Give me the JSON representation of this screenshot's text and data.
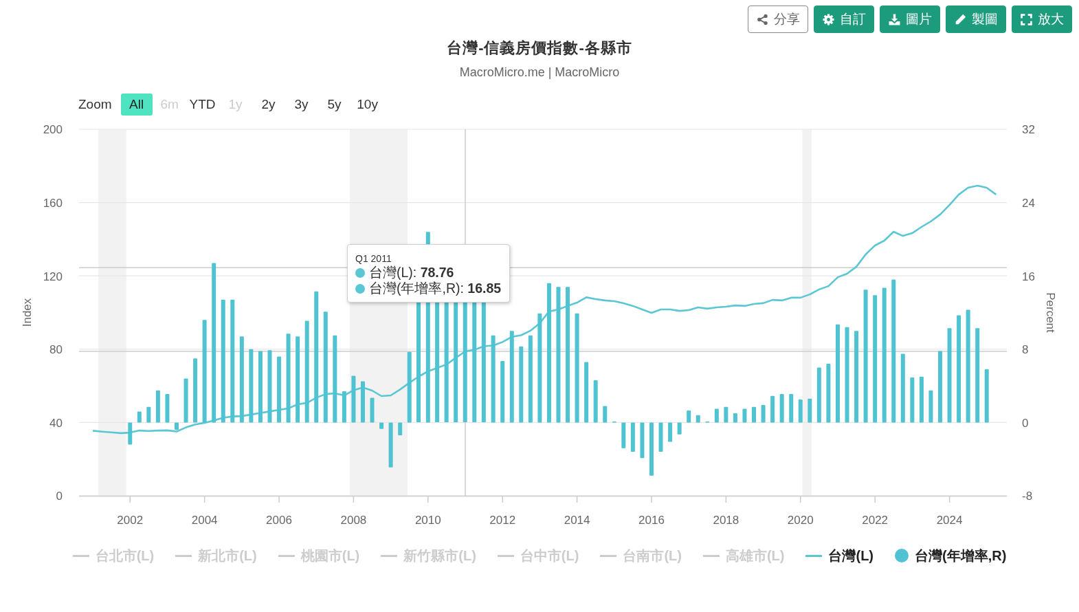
{
  "toolbar": [
    {
      "label": "分享",
      "kind": "outline"
    },
    {
      "label": "自訂",
      "kind": "filled"
    },
    {
      "label": "圖片",
      "kind": "filled"
    },
    {
      "label": "製圖",
      "kind": "filled"
    },
    {
      "label": "放大",
      "kind": "filled"
    }
  ],
  "title": "台灣-信義房價指數-各縣市",
  "subtitle": "MacroMicro.me | MacroMicro",
  "range_selector": {
    "label": "Zoom",
    "buttons": [
      {
        "label": "All",
        "selected": true,
        "disabled": false
      },
      {
        "label": "6m",
        "selected": false,
        "disabled": true
      },
      {
        "label": "YTD",
        "selected": false,
        "disabled": false
      },
      {
        "label": "1y",
        "selected": false,
        "disabled": true
      },
      {
        "label": "2y",
        "selected": false,
        "disabled": false
      },
      {
        "label": "3y",
        "selected": false,
        "disabled": false
      },
      {
        "label": "5y",
        "selected": false,
        "disabled": false
      },
      {
        "label": "10y",
        "selected": false,
        "disabled": false
      }
    ]
  },
  "chart": {
    "chart_data": {
      "type": "bar",
      "ylabel": "Index",
      "y2label": "Percent",
      "xlim": [
        2000.63,
        2025.54
      ],
      "ylim": [
        0,
        200
      ],
      "y2lim": [
        -8,
        32
      ],
      "xticks": [
        2002,
        2004,
        2006,
        2008,
        2010,
        2012,
        2014,
        2016,
        2018,
        2020,
        2022,
        2024
      ],
      "yticks": [
        0,
        40,
        80,
        120,
        160,
        200
      ],
      "y2ticks": [
        -8,
        0,
        8,
        16,
        24,
        32
      ],
      "grid": true,
      "x": [
        2001,
        2001.25,
        2001.5,
        2001.75,
        2002,
        2002.25,
        2002.5,
        2002.75,
        2003,
        2003.25,
        2003.5,
        2003.75,
        2004,
        2004.25,
        2004.5,
        2004.75,
        2005,
        2005.25,
        2005.5,
        2005.75,
        2006,
        2006.25,
        2006.5,
        2006.75,
        2007,
        2007.25,
        2007.5,
        2007.75,
        2008,
        2008.25,
        2008.5,
        2008.75,
        2009,
        2009.25,
        2009.5,
        2009.75,
        2010,
        2010.25,
        2010.5,
        2010.75,
        2011,
        2011.25,
        2011.5,
        2011.75,
        2012,
        2012.25,
        2012.5,
        2012.75,
        2013,
        2013.25,
        2013.5,
        2013.75,
        2014,
        2014.25,
        2014.5,
        2014.75,
        2015,
        2015.25,
        2015.5,
        2015.75,
        2016,
        2016.25,
        2016.5,
        2016.75,
        2017,
        2017.25,
        2017.5,
        2017.75,
        2018,
        2018.25,
        2018.5,
        2018.75,
        2019,
        2019.25,
        2019.5,
        2019.75,
        2020,
        2020.25,
        2020.5,
        2020.75,
        2021,
        2021.25,
        2021.5,
        2021.75,
        2022,
        2022.25,
        2022.5,
        2022.75,
        2023,
        2023.25,
        2023.5,
        2023.75,
        2024,
        2024.25,
        2024.5,
        2024.75,
        2025,
        2025.25
      ],
      "series": [
        {
          "name": "台灣(L)",
          "type": "line",
          "color": "#5bc6d4",
          "values": [
            35.5,
            35.0,
            34.6,
            34.2,
            34.5,
            35.6,
            35.4,
            35.6,
            35.7,
            35.1,
            37.3,
            38.9,
            39.8,
            41.1,
            42.6,
            43.3,
            43.5,
            44.3,
            45.2,
            46.0,
            46.9,
            47.7,
            49.9,
            50.7,
            53.5,
            55.5,
            55.9,
            54.8,
            57.6,
            59.1,
            57.4,
            54.4,
            54.8,
            58.0,
            61.7,
            65.1,
            67.9,
            69.8,
            71.7,
            75.4,
            78.8,
            79.7,
            81.6,
            82.0,
            83.9,
            86.7,
            87.6,
            90.1,
            94.2,
            100.6,
            101.7,
            103.6,
            105.4,
            108.3,
            107.3,
            106.6,
            106.2,
            105.1,
            103.6,
            101.7,
            99.8,
            101.7,
            101.7,
            100.9,
            101.3,
            102.8,
            102.1,
            102.8,
            103.2,
            103.9,
            103.6,
            104.7,
            105.1,
            106.9,
            106.6,
            108.1,
            108.1,
            109.9,
            112.6,
            114.4,
            119.3,
            121.2,
            125.0,
            131.7,
            136.6,
            139.2,
            144.1,
            141.8,
            143.3,
            146.7,
            149.7,
            153.5,
            158.7,
            164.4,
            168.1,
            169.2,
            168.1,
            164.4
          ]
        },
        {
          "name": "台灣(年增率,R)",
          "axis": "y2",
          "color": "#4fc3d1",
          "values": [
            null,
            null,
            null,
            null,
            -2.4,
            1.2,
            1.7,
            3.5,
            3.1,
            -0.8,
            4.8,
            7.0,
            11.2,
            17.4,
            13.4,
            13.4,
            9.4,
            8.0,
            7.8,
            7.9,
            7.2,
            9.7,
            9.4,
            11.1,
            14.3,
            12.1,
            9.5,
            3.4,
            5.1,
            4.5,
            2.7,
            -0.7,
            -4.9,
            -1.4,
            7.7,
            null,
            20.8,
            null,
            null,
            null,
            null,
            null,
            null,
            9.5,
            6.7,
            10.0,
            8.3,
            9.5,
            11.9,
            15.2,
            14.8,
            14.8,
            11.9,
            6.6,
            4.6,
            1.8,
            0.1,
            -2.8,
            -3.2,
            -3.9,
            -5.8,
            -3.2,
            -2.1,
            -1.3,
            1.3,
            0.8,
            0.1,
            1.5,
            1.7,
            1.0,
            1.5,
            1.7,
            1.9,
            2.9,
            3.1,
            3.1,
            2.5,
            2.6,
            6.0,
            6.4,
            10.7,
            10.4,
            10.0,
            14.5,
            13.9,
            14.7,
            15.6,
            7.5,
            4.9,
            5.0,
            3.5,
            7.8,
            10.3,
            11.7,
            12.3,
            10.3,
            5.8,
            null
          ]
        }
      ],
      "bands": [
        {
          "axis": "x",
          "from": 2001.15,
          "to": 2001.9
        },
        {
          "axis": "x",
          "from": 2007.9,
          "to": 2009.45
        },
        {
          "axis": "x",
          "from": 2020.05,
          "to": 2020.3
        }
      ],
      "ref_lines": [
        {
          "axis": "x",
          "value": 2011
        },
        {
          "axis": "y",
          "value": 78.8
        },
        {
          "axis": "y2",
          "value": 16.9
        }
      ]
    },
    "tooltip": {
      "title": "Q1 2011",
      "rows": [
        {
          "text": "台灣(L): **78.76**",
          "color": "#5bc6d4"
        },
        {
          "text": "台灣(年增率,R): **16.85**",
          "color": "#5bc6d4"
        }
      ]
    },
    "hidden_legend": [
      {
        "label": "台北市(L)",
        "visible": false
      },
      {
        "label": "新北市(L)",
        "visible": false
      },
      {
        "label": "桃園市(L)",
        "visible": false
      },
      {
        "label": "新竹縣市(L)",
        "visible": false
      },
      {
        "label": "台中市(L)",
        "visible": false
      },
      {
        "label": "台南市(L)",
        "visible": false
      },
      {
        "label": "高雄市(L)",
        "visible": false
      }
    ]
  }
}
